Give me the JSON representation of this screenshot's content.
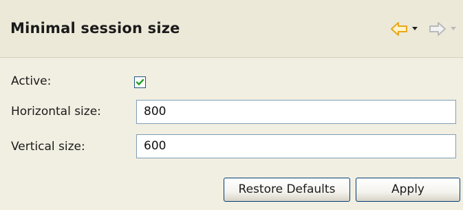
{
  "header": {
    "title": "Minimal session size",
    "back_icon": "back-arrow-icon",
    "forward_icon": "forward-arrow-icon",
    "accent_color": "#e8a61a",
    "disabled_color": "#b9b9b9"
  },
  "form": {
    "active_label": "Active:",
    "active_checked": true,
    "horizontal_label": "Horizontal size:",
    "horizontal_value": "800",
    "vertical_label": "Vertical size:",
    "vertical_value": "600"
  },
  "buttons": {
    "restore_label": "Restore Defaults",
    "apply_label": "Apply"
  }
}
